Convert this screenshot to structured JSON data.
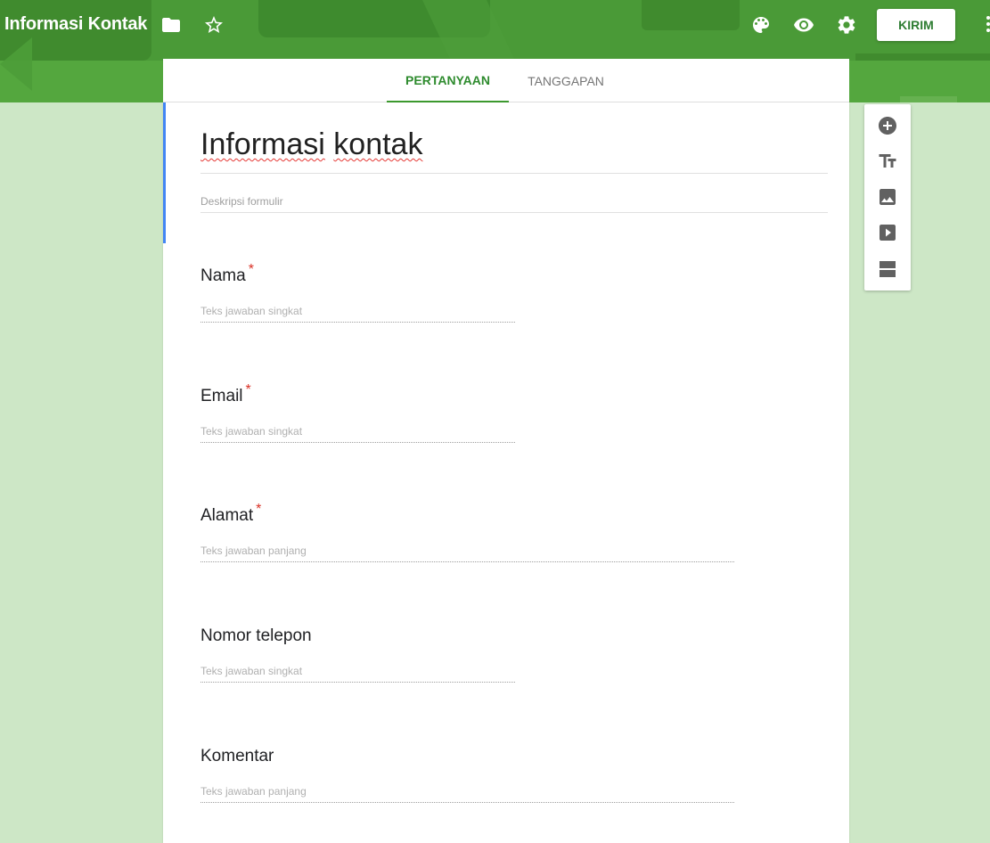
{
  "header": {
    "app_title": "Informasi Kontak",
    "send_label": "KIRIM",
    "icons": [
      "folder-icon",
      "star-icon",
      "palette-icon",
      "eye-icon",
      "gear-icon",
      "more-vert-icon"
    ]
  },
  "tabs": [
    {
      "label": "PERTANYAAN",
      "active": true
    },
    {
      "label": "TANGGAPAN",
      "active": false
    }
  ],
  "form": {
    "title_words": [
      "Informasi",
      "kontak"
    ],
    "description_placeholder": "Deskripsi formulir",
    "questions": [
      {
        "title": "Nama",
        "required": true,
        "answer_placeholder": "Teks jawaban singkat",
        "type": "short"
      },
      {
        "title": "Email",
        "required": true,
        "answer_placeholder": "Teks jawaban singkat",
        "type": "short"
      },
      {
        "title": "Alamat",
        "required": true,
        "answer_placeholder": "Teks jawaban panjang",
        "type": "long"
      },
      {
        "title": "Nomor telepon",
        "required": false,
        "answer_placeholder": "Teks jawaban singkat",
        "type": "short"
      },
      {
        "title": "Komentar",
        "required": false,
        "answer_placeholder": "Teks jawaban panjang",
        "type": "long"
      }
    ],
    "required_marker": "*"
  },
  "toolbar": {
    "tools": [
      "add-question-icon",
      "add-title-icon",
      "add-image-icon",
      "add-video-icon",
      "add-section-icon"
    ]
  },
  "colors": {
    "header_green": "#4a9a37",
    "background": "#cde7c6",
    "active_tab": "#2e8b2e",
    "accent_blue": "#4285f4",
    "required_red": "#d93025"
  }
}
